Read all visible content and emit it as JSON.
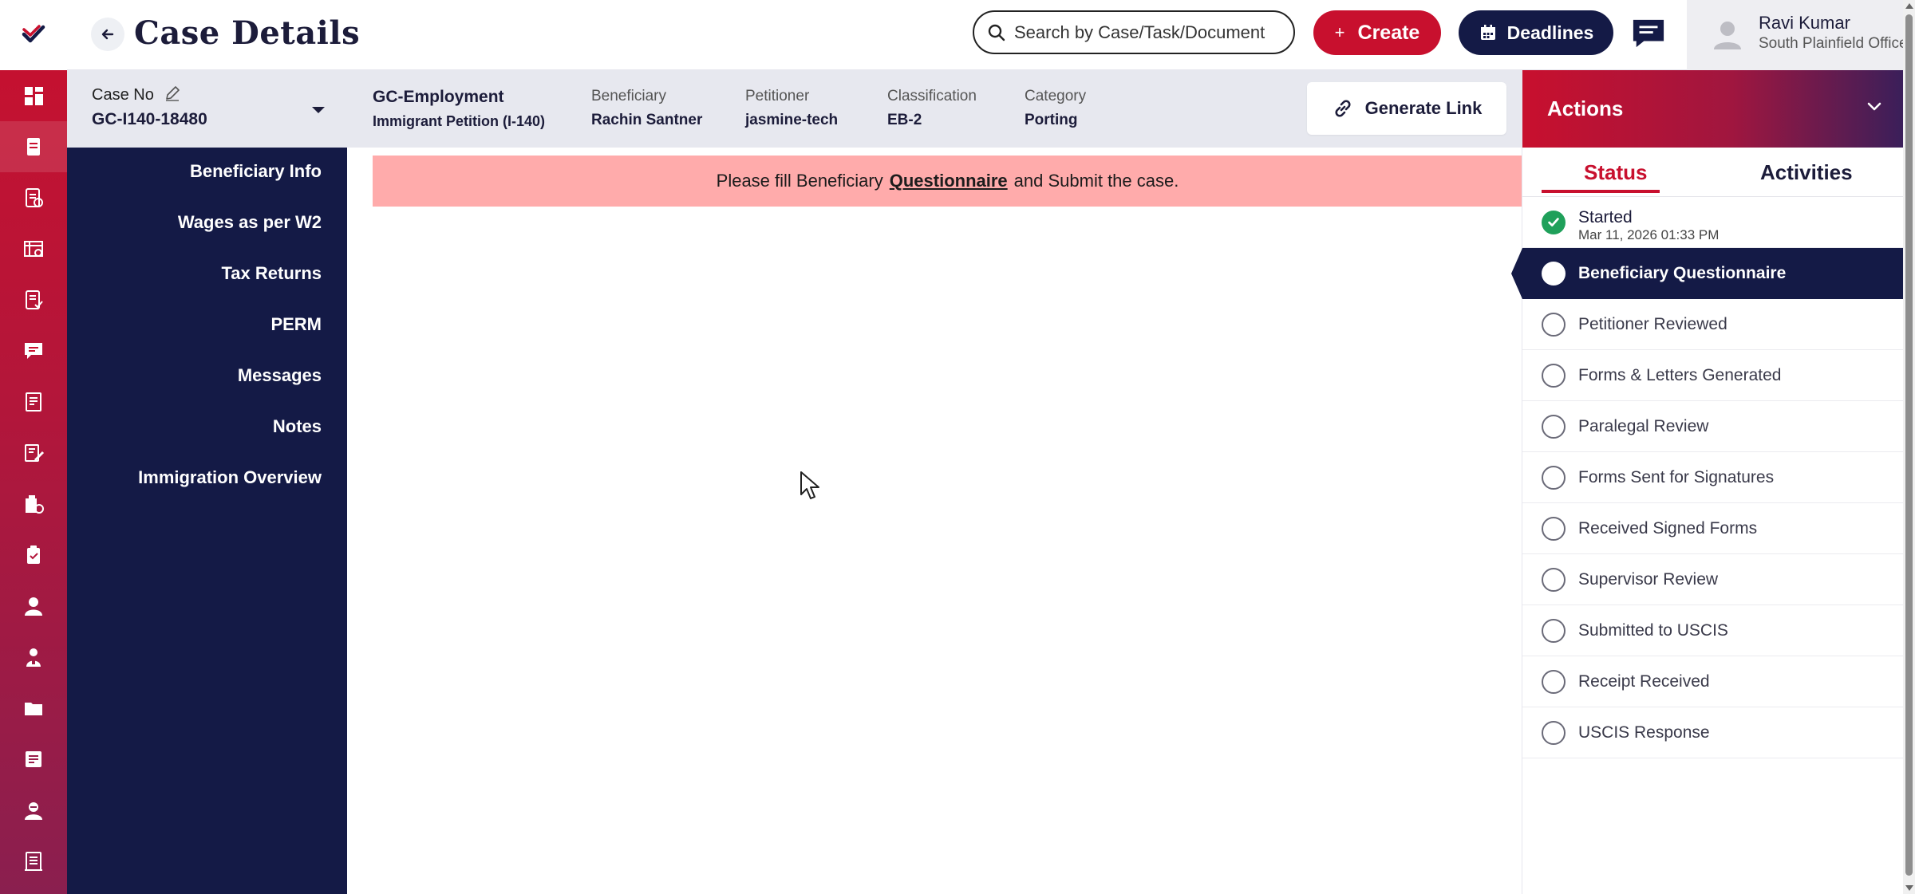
{
  "header": {
    "title": "Case Details",
    "search_placeholder": "Search by Case/Task/Document",
    "create_label": "Create",
    "deadlines_label": "Deadlines",
    "user_name": "Ravi Kumar",
    "user_office": "South Plainfield Office"
  },
  "case": {
    "case_no_label": "Case No",
    "case_no": "GC-I140-18480",
    "type_title": "GC-Employment",
    "type_subtitle": "Immigrant Petition (I-140)",
    "fields": [
      {
        "label": "Beneficiary",
        "value": "Rachin Santner"
      },
      {
        "label": "Petitioner",
        "value": "jasmine-tech"
      },
      {
        "label": "Classification",
        "value": "EB-2"
      },
      {
        "label": "Category",
        "value": "Porting"
      }
    ],
    "generate_link_label": "Generate Link"
  },
  "left_nav": {
    "items": [
      {
        "label": "Beneficiary Info"
      },
      {
        "label": "Wages as per W2"
      },
      {
        "label": "Tax Returns"
      },
      {
        "label": "PERM"
      },
      {
        "label": "Messages"
      },
      {
        "label": "Notes"
      },
      {
        "label": "Immigration Overview"
      }
    ]
  },
  "alert": {
    "prefix": "Please fill Beneficiary",
    "link": "Questionnaire",
    "suffix": "and Submit the case."
  },
  "actions_panel": {
    "title": "Actions",
    "tabs": [
      {
        "label": "Status",
        "active": true
      },
      {
        "label": "Activities",
        "active": false
      }
    ],
    "steps": [
      {
        "label": "Started",
        "sub": "Mar 11, 2026 01:33 PM",
        "state": "done"
      },
      {
        "label": "Beneficiary Questionnaire",
        "state": "current"
      },
      {
        "label": "Petitioner Reviewed",
        "state": "pending"
      },
      {
        "label": "Forms & Letters Generated",
        "state": "pending"
      },
      {
        "label": "Paralegal Review",
        "state": "pending"
      },
      {
        "label": "Forms Sent for Signatures",
        "state": "pending"
      },
      {
        "label": "Received Signed Forms",
        "state": "pending"
      },
      {
        "label": "Supervisor Review",
        "state": "pending"
      },
      {
        "label": "Submitted to USCIS",
        "state": "pending"
      },
      {
        "label": "Receipt Received",
        "state": "pending"
      },
      {
        "label": "USCIS Response",
        "state": "pending"
      }
    ]
  },
  "rail": {
    "icons": [
      "dashboard-icon",
      "cases-icon",
      "documents-icon",
      "forms-icon",
      "checklist-icon",
      "chat-icon",
      "book-icon",
      "edit-doc-icon",
      "org-doc-icon",
      "clipboard-icon",
      "person-icon",
      "people-icon",
      "folder-icon",
      "note-icon",
      "contact-icon",
      "ledger-icon"
    ]
  },
  "colors": {
    "brand_red": "#c8102e",
    "navy": "#141a46",
    "alert_bg": "#ffabab",
    "done_green": "#1fa05a"
  }
}
